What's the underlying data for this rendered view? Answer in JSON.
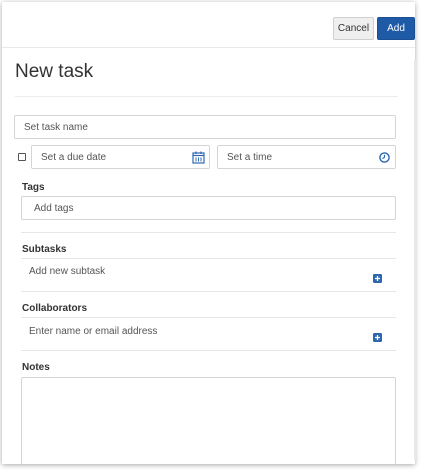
{
  "toolbar": {
    "cancel_label": "Cancel",
    "add_label": "Add"
  },
  "form": {
    "title": "New task",
    "task_name_placeholder": "Set task name",
    "due_date_placeholder": "Set a due date",
    "time_placeholder": "Set a time",
    "tags": {
      "label": "Tags",
      "placeholder": "Add tags"
    },
    "subtasks": {
      "label": "Subtasks",
      "add_text": "Add new subtask"
    },
    "collaborators": {
      "label": "Collaborators",
      "placeholder": "Enter name or email address"
    },
    "notes": {
      "label": "Notes",
      "value": ""
    }
  },
  "colors": {
    "primary": "#1f5aa6",
    "icon_blue": "#2d67b1"
  },
  "icons": [
    "calendar-icon",
    "clock-icon",
    "plus-icon"
  ]
}
